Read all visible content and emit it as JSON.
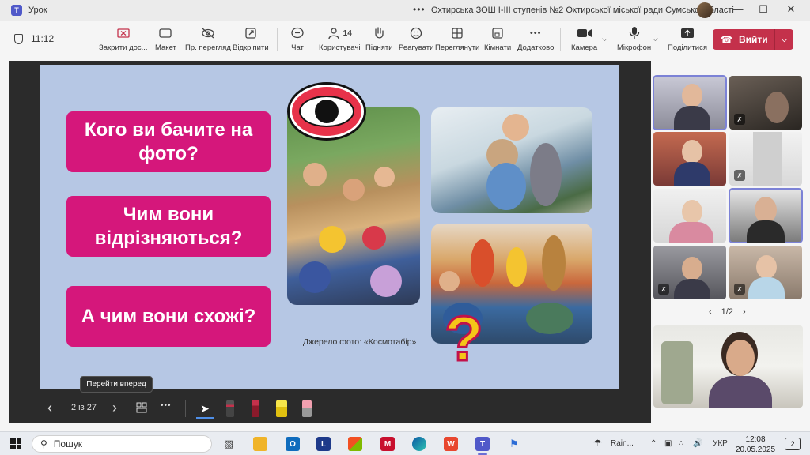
{
  "window": {
    "app_icon": "teams-icon",
    "title": "Урок",
    "more": "•••",
    "organization": "Охтирська ЗОШ І-ІІІ ступенів №2 Охтирської міської ради Сумської області",
    "minimize": "—",
    "maximize": "☐",
    "close": "✕"
  },
  "toolbar": {
    "timer": "11:12",
    "close_content": "Закрити дос...",
    "layout": "Макет",
    "private_view": "Пр. перегляд",
    "pop_out": "Відкріпити",
    "chat": "Чат",
    "people": "Користувачі",
    "people_count": "14",
    "raise": "Підняти",
    "react": "Реагувати",
    "view": "Переглянути",
    "rooms": "Кімнати",
    "more": "Додатково",
    "more_glyph": "•••",
    "camera": "Камера",
    "mic": "Мікрофон",
    "share": "Поділитися",
    "leave": "Вийти"
  },
  "slide": {
    "q1": "Кого ви бачите на фото?",
    "q2": "Чим вони відрізняються?",
    "q3": "А чим вони схожі?",
    "qmark": "?",
    "source": "Джерело фото: «Космотабір»"
  },
  "slide_controls": {
    "tooltip": "Перейти вперед",
    "prev": "‹",
    "counter": "2 із 27",
    "next": "›",
    "more": "•••"
  },
  "gallery": {
    "page": "1/2",
    "prev": "‹",
    "next": "›"
  },
  "taskbar": {
    "search_placeholder": "Пошук",
    "weather": "Rain...",
    "language": "УКР",
    "time": "12:08",
    "date": "20.05.2025",
    "notifications": "2",
    "app_letter_l": "L"
  },
  "colors": {
    "accent": "#d5177b",
    "slide_bg": "#b6c7e4",
    "leave": "#c4314b",
    "teams": "#5059c9"
  }
}
